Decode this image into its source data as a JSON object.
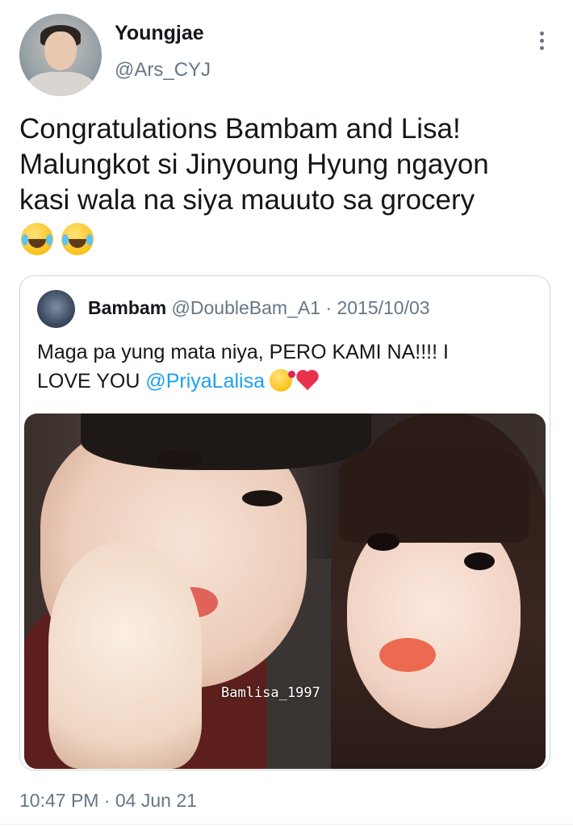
{
  "author": {
    "name": "Youngjae",
    "handle": "@Ars_CYJ"
  },
  "tweet": {
    "lines": [
      "Congratulations Bambam and Lisa!",
      "Malungkot si Jinyoung Hyung ngayon",
      "kasi wala na siya mauuto sa grocery"
    ],
    "emojis": [
      "face-with-tears-of-joy-icon",
      "face-with-tears-of-joy-icon"
    ]
  },
  "quoted": {
    "name": "Bambam",
    "handle": "@DoubleBam_A1",
    "separator": "·",
    "date": "2015/10/03",
    "text_line1": "Maga pa yung mata niya, PERO KAMI NA!!!! I",
    "text_line2_prefix": "LOVE YOU ",
    "mention": "@PriyaLalisa",
    "emojis": [
      "face-blowing-kiss-icon",
      "red-heart-icon"
    ],
    "photo_watermark": "Bamlisa_1997"
  },
  "timestamp": "10:47 PM · 04 Jun 21"
}
